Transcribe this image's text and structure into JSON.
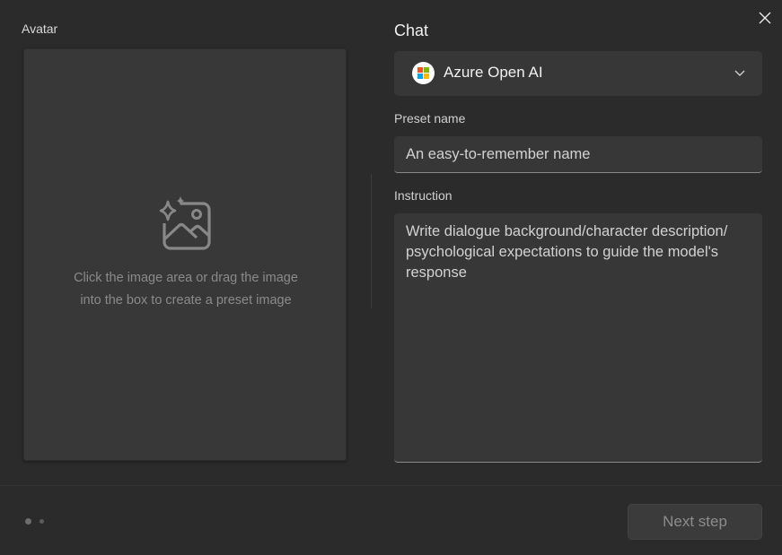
{
  "dialog": {
    "close_icon": "close-icon"
  },
  "avatar": {
    "label": "Avatar",
    "icon": "image-sparkle-icon",
    "hint_line1": "Click the image area or drag the image",
    "hint_line2": "into the box to create a preset image"
  },
  "chat": {
    "title": "Chat",
    "model": {
      "name": "Azure Open AI",
      "logo": "microsoft-logo-icon",
      "chevron": "chevron-down-icon"
    }
  },
  "preset": {
    "label": "Preset name",
    "placeholder": "An easy-to-remember name",
    "value": ""
  },
  "instruction": {
    "label": "Instruction",
    "placeholder": "Write dialogue background/character description/ psychological expectations to guide the model's response",
    "value": ""
  },
  "footer": {
    "step_count": 2,
    "current_step": 1,
    "next_label": "Next step"
  },
  "colors": {
    "background": "#2b2b2b",
    "panel": "#383838",
    "field": "#373737",
    "ms_red": "#f25022",
    "ms_green": "#7fba00",
    "ms_blue": "#00a4ef",
    "ms_yellow": "#ffb900"
  }
}
